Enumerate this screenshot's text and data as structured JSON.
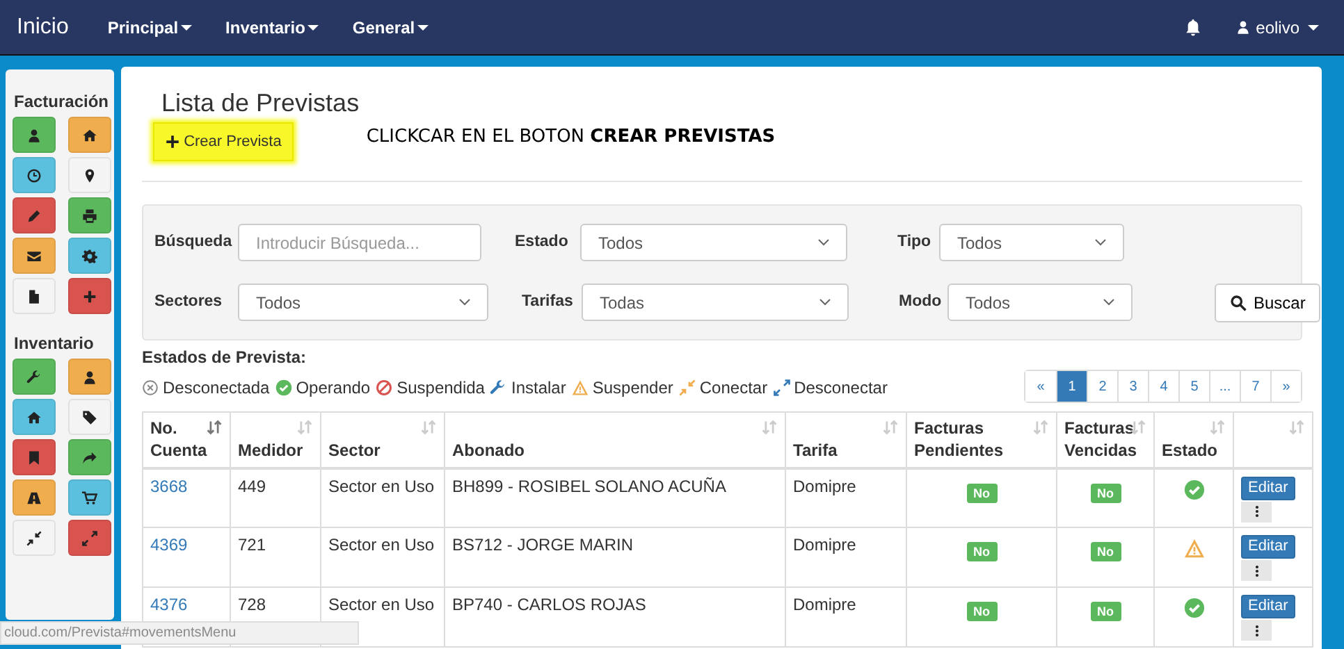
{
  "navbar": {
    "brand": "Inicio",
    "menus": [
      {
        "label": "Principal"
      },
      {
        "label": "Inventario"
      },
      {
        "label": "General"
      }
    ],
    "user": "eolivo"
  },
  "sidebar": {
    "sections": [
      {
        "title": "Facturación",
        "buttons": [
          {
            "color": "#5cb85c"
          },
          {
            "color": "#f0ad4e"
          },
          {
            "color": "#5bc0de"
          },
          {
            "color": "#f4f4f4"
          },
          {
            "color": "#d9534f"
          },
          {
            "color": "#5cb85c"
          },
          {
            "color": "#f0ad4e"
          },
          {
            "color": "#5bc0de"
          },
          {
            "color": "#f4f4f4"
          },
          {
            "color": "#d9534f"
          }
        ]
      },
      {
        "title": "Inventario",
        "buttons": [
          {
            "color": "#5cb85c"
          },
          {
            "color": "#f0ad4e"
          },
          {
            "color": "#5bc0de"
          },
          {
            "color": "#f4f4f4"
          },
          {
            "color": "#d9534f"
          },
          {
            "color": "#5cb85c"
          },
          {
            "color": "#f0ad4e"
          },
          {
            "color": "#5bc0de"
          },
          {
            "color": "#f4f4f4"
          },
          {
            "color": "#d9534f"
          }
        ]
      }
    ]
  },
  "page": {
    "title": "Lista de Previstas",
    "create_button": {
      "label": "Crear Prevista",
      "highlighted": true
    },
    "annotation": "CLICKCAR EN EL BOTON **CREAR PREVISTAS**"
  },
  "filters": [
    [
      {
        "label": "Búsqueda",
        "kind": "input",
        "placeholder": "Introducir Búsqueda..."
      },
      {
        "label": "Estado",
        "kind": "select",
        "value": "Todos"
      },
      {
        "label": "Tipo",
        "kind": "select",
        "value": "Todos"
      }
    ],
    [
      {
        "label": "Sectores",
        "kind": "select",
        "value": "Todos"
      },
      {
        "label": "Tarifas",
        "kind": "select",
        "value": "Todas"
      },
      {
        "label": "Modo",
        "kind": "select",
        "value": "Todos"
      }
    ]
  ],
  "search_button": "Buscar",
  "legend": {
    "title": "Estados de Prevista:",
    "items": [
      "Desconectada",
      "Operando",
      "Suspendida",
      "Instalar",
      "Suspender",
      "Conectar",
      "Desconectar"
    ]
  },
  "pagination": [
    {
      "label": "«",
      "selected": false
    },
    {
      "label": "1",
      "selected": true
    },
    {
      "label": "2",
      "selected": false
    },
    {
      "label": "3",
      "selected": false
    },
    {
      "label": "4",
      "selected": false
    },
    {
      "label": "5",
      "selected": false
    },
    {
      "label": "...",
      "selected": false
    },
    {
      "label": "7",
      "selected": false
    },
    {
      "label": "»",
      "selected": false
    }
  ],
  "table": {
    "columns": [
      {
        "label": "No. Cuenta",
        "sorted": true
      },
      {
        "label": "Medidor",
        "sorted": false
      },
      {
        "label": "Sector",
        "sorted": false
      },
      {
        "label": "Abonado",
        "sorted": false
      },
      {
        "label": "Tarifa",
        "sorted": false
      },
      {
        "label": "Facturas Pendientes",
        "sorted": false
      },
      {
        "label": "Facturas Vencidas",
        "sorted": false
      },
      {
        "label": "Estado",
        "sorted": false
      },
      {
        "sorted": false
      }
    ],
    "rows": [
      {
        "cuenta": "3668",
        "medidor": "449",
        "sector": "Sector en Uso",
        "abonado": "BH899 - ROSIBEL SOLANO ACUÑA",
        "tarifa": "Domipre",
        "pendientes": "No",
        "vencidas": "No",
        "kind": "ok",
        "edit": "Editar"
      },
      {
        "cuenta": "4369",
        "medidor": "721",
        "sector": "Sector en Uso",
        "abonado": "BS712 - JORGE MARIN",
        "tarifa": "Domipre",
        "pendientes": "No",
        "vencidas": "No",
        "kind": "warning",
        "edit": "Editar"
      },
      {
        "cuenta": "4376",
        "medidor": "728",
        "sector": "Sector en Uso",
        "abonado": "BP740 - CARLOS ROJAS",
        "tarifa": "Domipre",
        "pendientes": "No",
        "vencidas": "No",
        "kind": "ok",
        "edit": "Editar"
      }
    ]
  },
  "status_url": "cloud.com/Prevista#movementsMenu"
}
